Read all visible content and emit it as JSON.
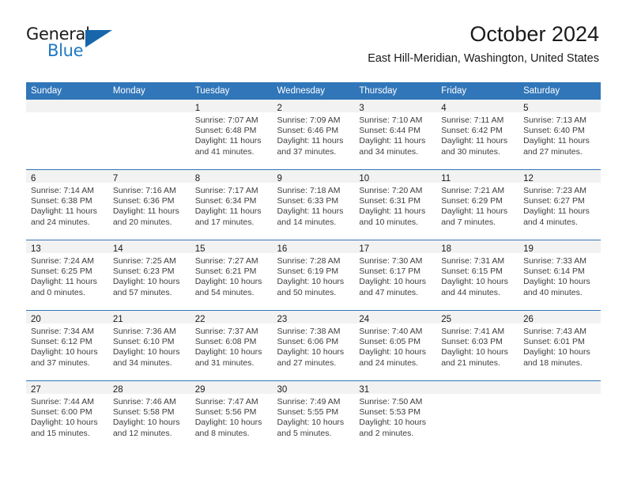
{
  "brand": {
    "name_part1": "General",
    "name_part2": "Blue",
    "triangle_color": "#1766ab",
    "blue_color": "#1f79c4"
  },
  "header": {
    "title": "October 2024",
    "location": "East Hill-Meridian, Washington, United States"
  },
  "theme": {
    "header_blue": "#3176b9",
    "daynum_band": "#f2f2f2",
    "text": "#1a1a1a"
  },
  "calendar": {
    "weekday_headers": [
      "Sunday",
      "Monday",
      "Tuesday",
      "Wednesday",
      "Thursday",
      "Friday",
      "Saturday"
    ],
    "weeks": [
      [
        {
          "day": "",
          "sunrise": "",
          "sunset": "",
          "daylight_line1": "",
          "daylight_line2": "",
          "empty": true
        },
        {
          "day": "",
          "sunrise": "",
          "sunset": "",
          "daylight_line1": "",
          "daylight_line2": "",
          "empty": true
        },
        {
          "day": "1",
          "sunrise": "Sunrise: 7:07 AM",
          "sunset": "Sunset: 6:48 PM",
          "daylight_line1": "Daylight: 11 hours",
          "daylight_line2": "and 41 minutes."
        },
        {
          "day": "2",
          "sunrise": "Sunrise: 7:09 AM",
          "sunset": "Sunset: 6:46 PM",
          "daylight_line1": "Daylight: 11 hours",
          "daylight_line2": "and 37 minutes."
        },
        {
          "day": "3",
          "sunrise": "Sunrise: 7:10 AM",
          "sunset": "Sunset: 6:44 PM",
          "daylight_line1": "Daylight: 11 hours",
          "daylight_line2": "and 34 minutes."
        },
        {
          "day": "4",
          "sunrise": "Sunrise: 7:11 AM",
          "sunset": "Sunset: 6:42 PM",
          "daylight_line1": "Daylight: 11 hours",
          "daylight_line2": "and 30 minutes."
        },
        {
          "day": "5",
          "sunrise": "Sunrise: 7:13 AM",
          "sunset": "Sunset: 6:40 PM",
          "daylight_line1": "Daylight: 11 hours",
          "daylight_line2": "and 27 minutes."
        }
      ],
      [
        {
          "day": "6",
          "sunrise": "Sunrise: 7:14 AM",
          "sunset": "Sunset: 6:38 PM",
          "daylight_line1": "Daylight: 11 hours",
          "daylight_line2": "and 24 minutes."
        },
        {
          "day": "7",
          "sunrise": "Sunrise: 7:16 AM",
          "sunset": "Sunset: 6:36 PM",
          "daylight_line1": "Daylight: 11 hours",
          "daylight_line2": "and 20 minutes."
        },
        {
          "day": "8",
          "sunrise": "Sunrise: 7:17 AM",
          "sunset": "Sunset: 6:34 PM",
          "daylight_line1": "Daylight: 11 hours",
          "daylight_line2": "and 17 minutes."
        },
        {
          "day": "9",
          "sunrise": "Sunrise: 7:18 AM",
          "sunset": "Sunset: 6:33 PM",
          "daylight_line1": "Daylight: 11 hours",
          "daylight_line2": "and 14 minutes."
        },
        {
          "day": "10",
          "sunrise": "Sunrise: 7:20 AM",
          "sunset": "Sunset: 6:31 PM",
          "daylight_line1": "Daylight: 11 hours",
          "daylight_line2": "and 10 minutes."
        },
        {
          "day": "11",
          "sunrise": "Sunrise: 7:21 AM",
          "sunset": "Sunset: 6:29 PM",
          "daylight_line1": "Daylight: 11 hours",
          "daylight_line2": "and 7 minutes."
        },
        {
          "day": "12",
          "sunrise": "Sunrise: 7:23 AM",
          "sunset": "Sunset: 6:27 PM",
          "daylight_line1": "Daylight: 11 hours",
          "daylight_line2": "and 4 minutes."
        }
      ],
      [
        {
          "day": "13",
          "sunrise": "Sunrise: 7:24 AM",
          "sunset": "Sunset: 6:25 PM",
          "daylight_line1": "Daylight: 11 hours",
          "daylight_line2": "and 0 minutes."
        },
        {
          "day": "14",
          "sunrise": "Sunrise: 7:25 AM",
          "sunset": "Sunset: 6:23 PM",
          "daylight_line1": "Daylight: 10 hours",
          "daylight_line2": "and 57 minutes."
        },
        {
          "day": "15",
          "sunrise": "Sunrise: 7:27 AM",
          "sunset": "Sunset: 6:21 PM",
          "daylight_line1": "Daylight: 10 hours",
          "daylight_line2": "and 54 minutes."
        },
        {
          "day": "16",
          "sunrise": "Sunrise: 7:28 AM",
          "sunset": "Sunset: 6:19 PM",
          "daylight_line1": "Daylight: 10 hours",
          "daylight_line2": "and 50 minutes."
        },
        {
          "day": "17",
          "sunrise": "Sunrise: 7:30 AM",
          "sunset": "Sunset: 6:17 PM",
          "daylight_line1": "Daylight: 10 hours",
          "daylight_line2": "and 47 minutes."
        },
        {
          "day": "18",
          "sunrise": "Sunrise: 7:31 AM",
          "sunset": "Sunset: 6:15 PM",
          "daylight_line1": "Daylight: 10 hours",
          "daylight_line2": "and 44 minutes."
        },
        {
          "day": "19",
          "sunrise": "Sunrise: 7:33 AM",
          "sunset": "Sunset: 6:14 PM",
          "daylight_line1": "Daylight: 10 hours",
          "daylight_line2": "and 40 minutes."
        }
      ],
      [
        {
          "day": "20",
          "sunrise": "Sunrise: 7:34 AM",
          "sunset": "Sunset: 6:12 PM",
          "daylight_line1": "Daylight: 10 hours",
          "daylight_line2": "and 37 minutes."
        },
        {
          "day": "21",
          "sunrise": "Sunrise: 7:36 AM",
          "sunset": "Sunset: 6:10 PM",
          "daylight_line1": "Daylight: 10 hours",
          "daylight_line2": "and 34 minutes."
        },
        {
          "day": "22",
          "sunrise": "Sunrise: 7:37 AM",
          "sunset": "Sunset: 6:08 PM",
          "daylight_line1": "Daylight: 10 hours",
          "daylight_line2": "and 31 minutes."
        },
        {
          "day": "23",
          "sunrise": "Sunrise: 7:38 AM",
          "sunset": "Sunset: 6:06 PM",
          "daylight_line1": "Daylight: 10 hours",
          "daylight_line2": "and 27 minutes."
        },
        {
          "day": "24",
          "sunrise": "Sunrise: 7:40 AM",
          "sunset": "Sunset: 6:05 PM",
          "daylight_line1": "Daylight: 10 hours",
          "daylight_line2": "and 24 minutes."
        },
        {
          "day": "25",
          "sunrise": "Sunrise: 7:41 AM",
          "sunset": "Sunset: 6:03 PM",
          "daylight_line1": "Daylight: 10 hours",
          "daylight_line2": "and 21 minutes."
        },
        {
          "day": "26",
          "sunrise": "Sunrise: 7:43 AM",
          "sunset": "Sunset: 6:01 PM",
          "daylight_line1": "Daylight: 10 hours",
          "daylight_line2": "and 18 minutes."
        }
      ],
      [
        {
          "day": "27",
          "sunrise": "Sunrise: 7:44 AM",
          "sunset": "Sunset: 6:00 PM",
          "daylight_line1": "Daylight: 10 hours",
          "daylight_line2": "and 15 minutes."
        },
        {
          "day": "28",
          "sunrise": "Sunrise: 7:46 AM",
          "sunset": "Sunset: 5:58 PM",
          "daylight_line1": "Daylight: 10 hours",
          "daylight_line2": "and 12 minutes."
        },
        {
          "day": "29",
          "sunrise": "Sunrise: 7:47 AM",
          "sunset": "Sunset: 5:56 PM",
          "daylight_line1": "Daylight: 10 hours",
          "daylight_line2": "and 8 minutes."
        },
        {
          "day": "30",
          "sunrise": "Sunrise: 7:49 AM",
          "sunset": "Sunset: 5:55 PM",
          "daylight_line1": "Daylight: 10 hours",
          "daylight_line2": "and 5 minutes."
        },
        {
          "day": "31",
          "sunrise": "Sunrise: 7:50 AM",
          "sunset": "Sunset: 5:53 PM",
          "daylight_line1": "Daylight: 10 hours",
          "daylight_line2": "and 2 minutes."
        },
        {
          "day": "",
          "sunrise": "",
          "sunset": "",
          "daylight_line1": "",
          "daylight_line2": "",
          "empty": true
        },
        {
          "day": "",
          "sunrise": "",
          "sunset": "",
          "daylight_line1": "",
          "daylight_line2": "",
          "empty": true
        }
      ]
    ]
  }
}
